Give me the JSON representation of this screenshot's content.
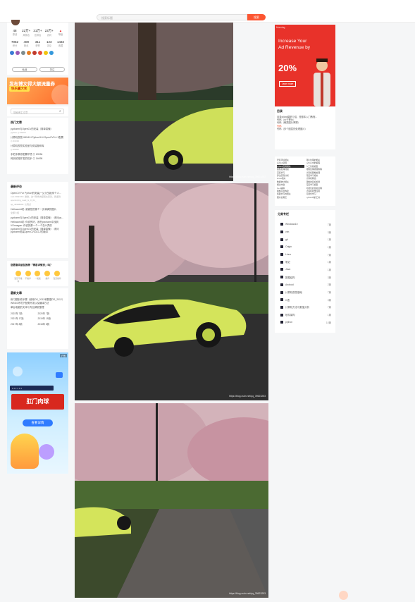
{
  "search": {
    "placeholder": "搜索标题",
    "button": "搜索"
  },
  "profile": {
    "stats_row1": [
      {
        "value": "48",
        "label": "原创"
      },
      {
        "value": "22万+",
        "label": "周排名"
      },
      {
        "value": "31万+",
        "label": "总排名"
      },
      {
        "value": "23万+",
        "label": "访问"
      },
      {
        "value": "",
        "label": "等级"
      }
    ],
    "stats_row2": [
      {
        "value": "7052",
        "label": "积分"
      },
      {
        "value": "409",
        "label": "粉丝"
      },
      {
        "value": "311",
        "label": "获赞"
      },
      {
        "value": "123",
        "label": "评论"
      },
      {
        "value": "1432",
        "label": "收藏"
      }
    ],
    "badge_colors": [
      "#3a7bd5",
      "#9b59b6",
      "#7f8c8d",
      "#e67e22",
      "#c0392b",
      "#e74c3c",
      "#f1c40f",
      "#3498db"
    ],
    "buttons": {
      "chat": "私信",
      "follow": "关注"
    }
  },
  "promo": {
    "title": "发布博文得大额流量券",
    "tag": "快乐赢大奖"
  },
  "blog_search": {
    "placeholder": "搜索博主文章"
  },
  "hot": {
    "title": "热门文章",
    "items": [
      {
        "text": "pycharm与OpenCV的安装（简单易懂）",
        "meta": "python ◎ 36464"
      },
      {
        "text": "计算机视觉-WIN10+Python3.6+OpenCV3.4.1配置",
        "meta": "◎ 31019"
      },
      {
        "text": "计算机视觉实验室与安装各种库",
        "meta": "◎ 30302"
      },
      {
        "text": "手把手教你配置环境 ◎ 19936",
        "meta": ""
      },
      {
        "text": "网页前端开发的初步 ◎ 14698",
        "meta": ""
      }
    ]
  },
  "latest": {
    "title": "最新评论",
    "items": [
      {
        "text": "OpenCV For Python的安装(一)(小白版)你个人...",
        "meta": "mzL7292XXX: 谢谢，这个软件的配置太复杂，我遇到opencv(ing_read_G_0_01_",
        "sub": "qq_45998393: 认真点"
      },
      {
        "text": "Helloworld初: 谢谢您的那个一步满满的图片",
        "meta": "全部介绍",
        "sub": "qq_45998393: 认真点"
      },
      {
        "text": "pycharm与OpenCV的安装（简单易懂）: 请问pycharm",
        "meta": "",
        "sub": ""
      },
      {
        "text": "Helloworld初: 你说的好，我在pycharm中找到",
        "meta": "",
        "sub": ""
      },
      {
        "text": "VOnnagan: 你说的那一个一个怎么弄的",
        "meta": "",
        "sub": ""
      },
      {
        "text": "pycharm与OpenCV的安装（简单易懂）: 请问pycharm安装OpenCV2022.2的版本",
        "meta": "",
        "sub": ""
      }
    ]
  },
  "rating": {
    "title": "您愿意向朋友推荐「博客详情页」吗？",
    "options": [
      "强烈不推荐",
      "不推荐",
      "一般般",
      "推荐",
      "强烈推荐"
    ]
  },
  "recent": {
    "title": "最新文章",
    "items": [
      "练习题制作步骤（使用OS_2012和数据OS_2012）",
      "WIN10环境下配置开发以及编译方法",
      "单台电脑的文本与专业解析整理"
    ],
    "archive": [
      {
        "year": "2022年",
        "count": "7篇"
      },
      {
        "year": "2020年",
        "count": "7篇"
      },
      {
        "year": "2021年",
        "count": "17篇"
      },
      {
        "year": "2019年",
        "count": "15篇"
      },
      {
        "year": "2017年",
        "count": "8篇"
      },
      {
        "year": "2018年",
        "count": "8篇"
      }
    ]
  },
  "ad_left": {
    "banner": "肛门肉球",
    "button": "查看详情",
    "tag": "广告"
  },
  "photos": [
    {
      "watermark": "https://blog.csdn.net/qq_39623253"
    },
    {
      "watermark": "https://blog.csdn.net/qq_39623253"
    },
    {
      "watermark": "https://blog.csdn.net/qq_39623253"
    }
  ],
  "ad_right": {
    "channel": "Monetag",
    "headline": "Increase Your Ad Revenue by",
    "percent": "20%",
    "cta": "Learn more"
  },
  "toc": {
    "title": "目录",
    "items": [
      "目录pillow模型介绍，是基本入门教程...",
      "代码（大于等价）",
      "代码（两类图片摩擦）",
      "代码",
      "代码（多个图层的处理图片）"
    ]
  },
  "categories_small": [
    "安装环境相关",
    "图片处理的相关",
    "python使用",
    "python中的编程",
    "python应用相关",
    "人工智能模型",
    "图像处理视频",
    "图像处理视频教程",
    "深度学习",
    "计算机图像处理",
    "算法实现分析",
    "深度学习相关",
    "Linux相关",
    "计算机网络",
    "数据统计相关",
    "图像的目标检测",
    "相关内容",
    "深度学习模型",
    "C++编程",
    "可视化的目标处理",
    "图像平台构建",
    "计算机视觉应用",
    "机器学习的相关",
    "可视化学习",
    "图片的其它",
    "python中的工具"
  ],
  "categories": {
    "title": "分类专栏",
    "items": [
      {
        "name": "Windows10",
        "count": "7篇"
      },
      {
        "name": "vim",
        "count": "3篇"
      },
      {
        "name": "git",
        "count": "1篇"
      },
      {
        "name": "Origin",
        "count": "1篇"
      },
      {
        "name": "Linux",
        "count": "7篇"
      },
      {
        "name": "笔记",
        "count": "1篇"
      },
      {
        "name": "Java",
        "count": "1篇"
      },
      {
        "name": "数据结构",
        "count": "3篇"
      },
      {
        "name": "Android",
        "count": "2篇"
      },
      {
        "name": "计算机视觉基础",
        "count": "7篇"
      },
      {
        "name": "C语",
        "count": "3篇"
      },
      {
        "name": "计算机方法与数值分析",
        "count": "7篇"
      },
      {
        "name": "软件架构",
        "count": "1篇"
      },
      {
        "name": "python",
        "count": "10篇"
      }
    ]
  }
}
